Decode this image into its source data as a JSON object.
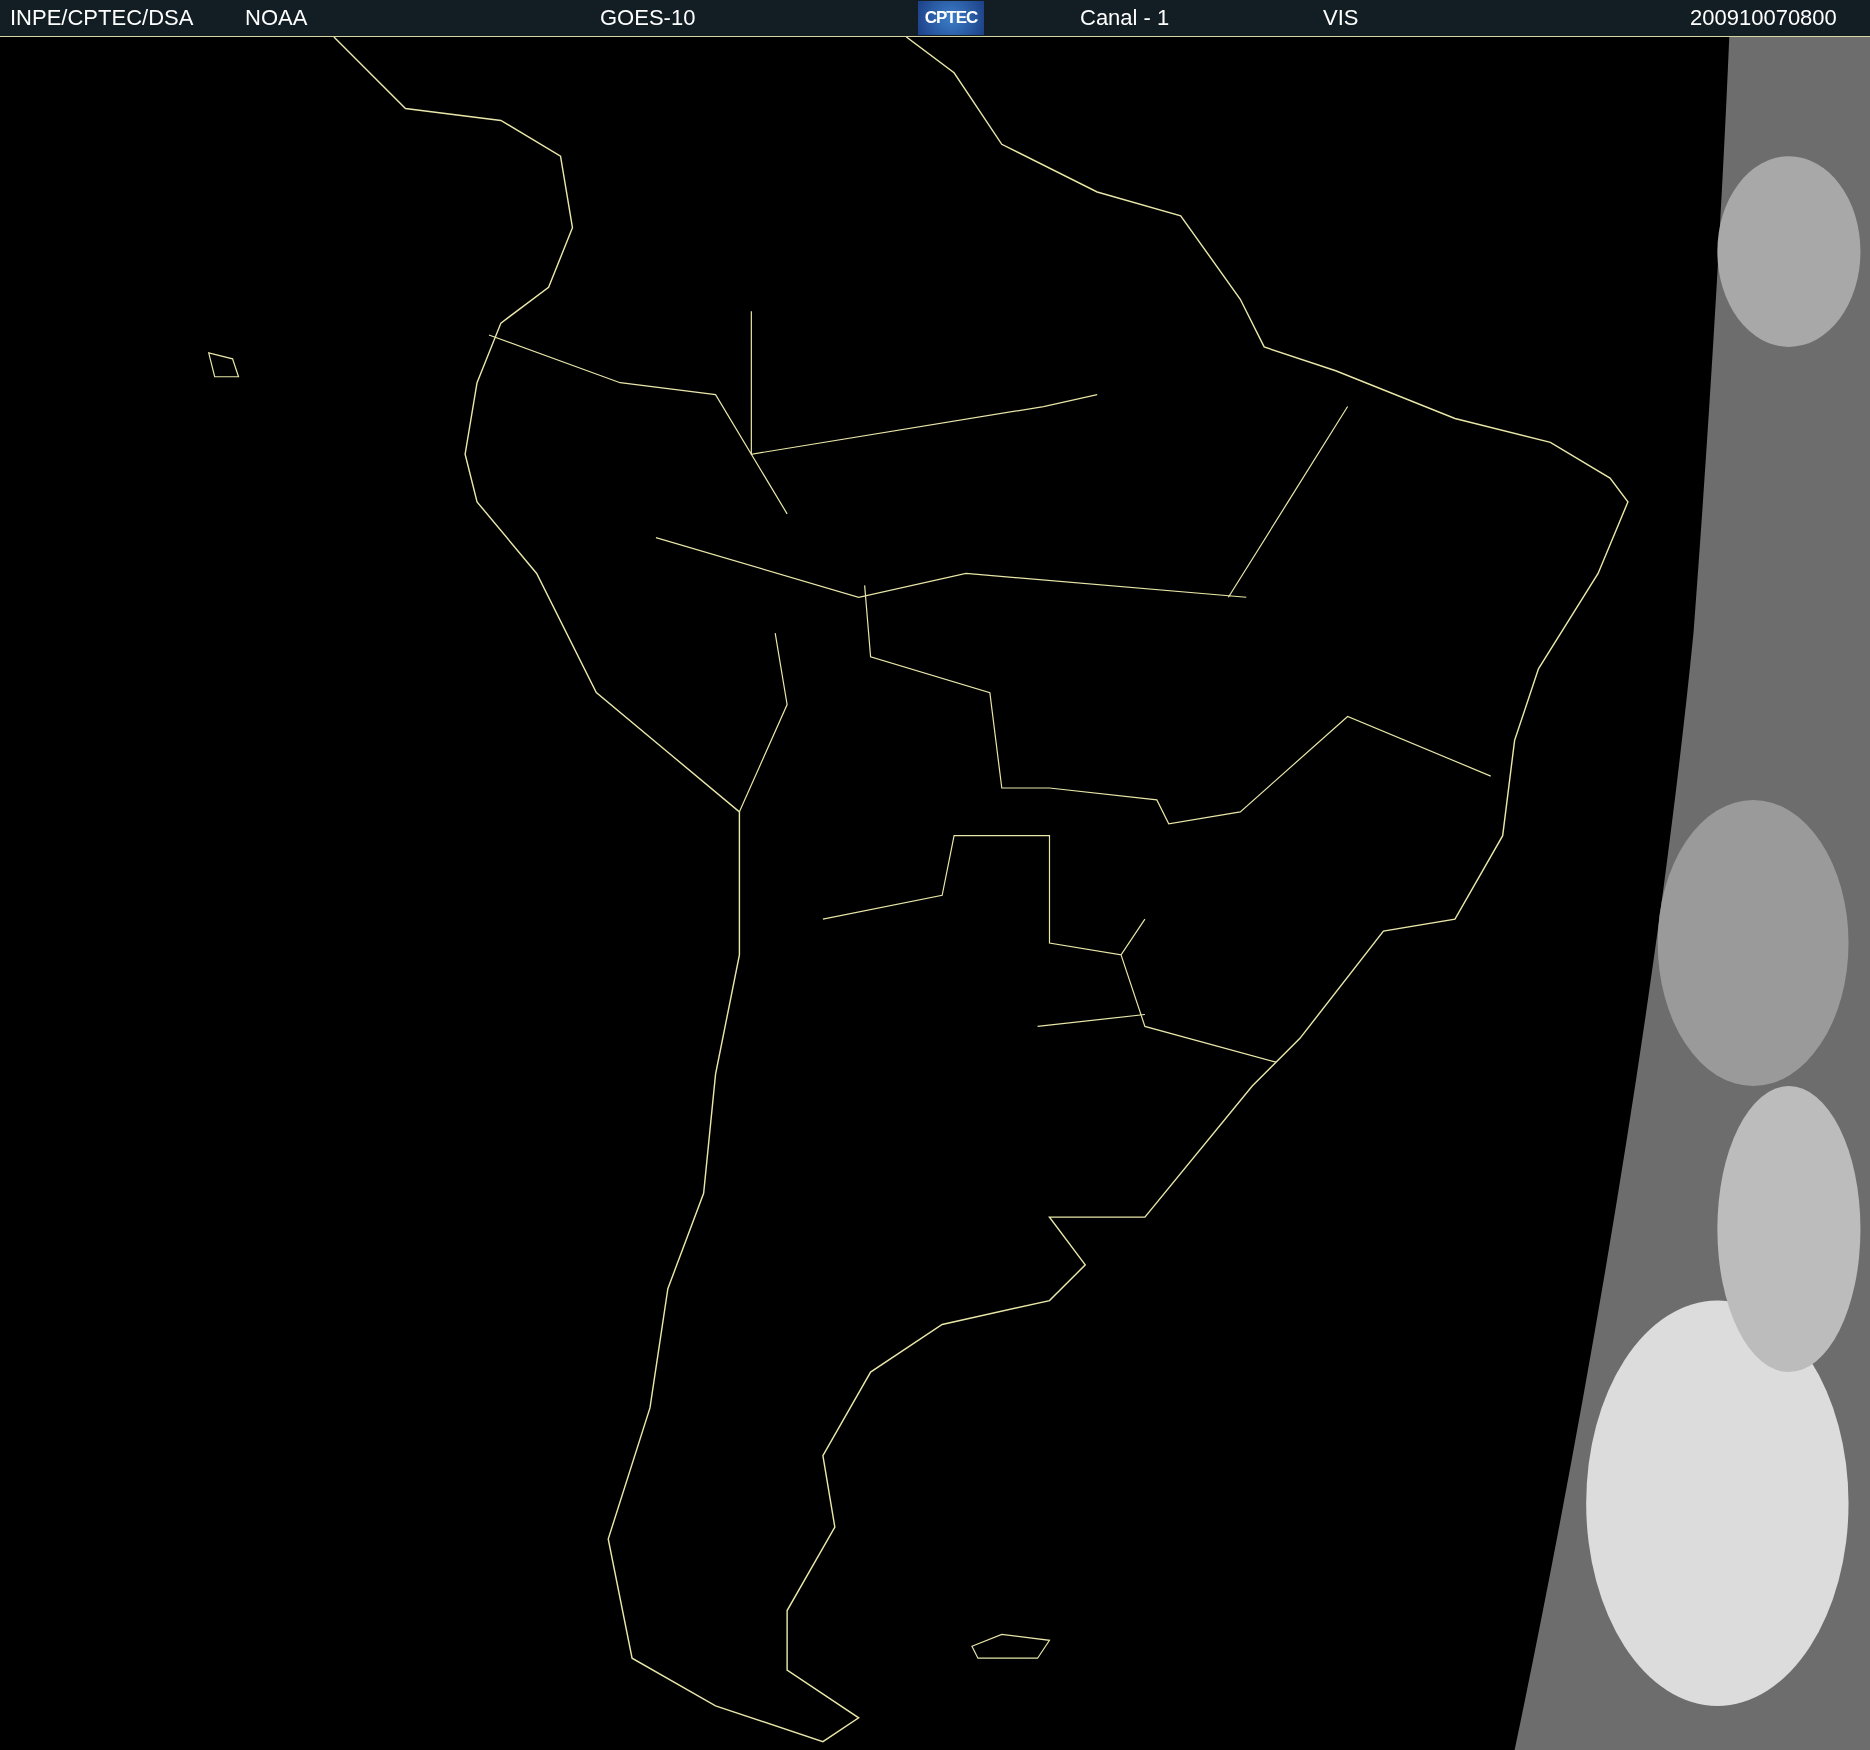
{
  "header": {
    "institution": "INPE/CPTEC/DSA",
    "agency": "NOAA",
    "satellite": "GOES-10",
    "logo": "CPTEC",
    "channel": "Canal - 1",
    "band": "VIS",
    "timestamp": "200910070800"
  }
}
